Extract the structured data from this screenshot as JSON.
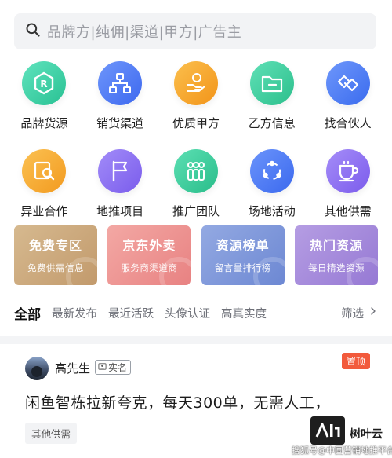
{
  "search": {
    "placeholder": "品牌方|纯佣|渠道|甲方|广告主"
  },
  "grid": [
    {
      "label": "品牌货源",
      "icon": "brand-r-icon",
      "color": "#3fd1a9"
    },
    {
      "label": "销货渠道",
      "icon": "org-chart-icon",
      "color": "#4d7cf6"
    },
    {
      "label": "优质甲方",
      "icon": "hand-coin-icon",
      "color": "#f6a526"
    },
    {
      "label": "乙方信息",
      "icon": "folder-icon",
      "color": "#3fcf9f"
    },
    {
      "label": "找合伙人",
      "icon": "handshake-icon",
      "color": "#4a7cf3"
    },
    {
      "label": "异业合作",
      "icon": "shop-search-icon",
      "color": "#f6a928"
    },
    {
      "label": "地推项目",
      "icon": "flag-icon",
      "color": "#8b6ff2"
    },
    {
      "label": "推广团队",
      "icon": "team-icon",
      "color": "#3ccb98"
    },
    {
      "label": "场地活动",
      "icon": "share-nodes-icon",
      "color": "#4b7df4"
    },
    {
      "label": "其他供需",
      "icon": "cup-icon",
      "color": "#8e6ef2"
    }
  ],
  "promos": [
    {
      "title": "免费专区",
      "subtitle": "免费供需信息",
      "color": "#c8a67c"
    },
    {
      "title": "京东外卖",
      "subtitle": "服务商渠道商",
      "color": "#ea8f8f"
    },
    {
      "title": "资源榜单",
      "subtitle": "留言量排行榜",
      "color": "#7d96d8"
    },
    {
      "title": "热门资源",
      "subtitle": "每日精选资源",
      "color": "#a68ad9"
    }
  ],
  "tabs": {
    "items": [
      "全部",
      "最新发布",
      "最近活跃",
      "头像认证",
      "高真实度"
    ],
    "filter": "筛选"
  },
  "post": {
    "username": "高先生",
    "verified": "实名",
    "pinned": "置顶",
    "text": "闲鱼智栋拉新夸克，每天300单，无需人工，",
    "tag": "其他供需"
  },
  "watermark": {
    "name": "树叶云",
    "sub": "搜狐号@中国营销地推平台"
  }
}
